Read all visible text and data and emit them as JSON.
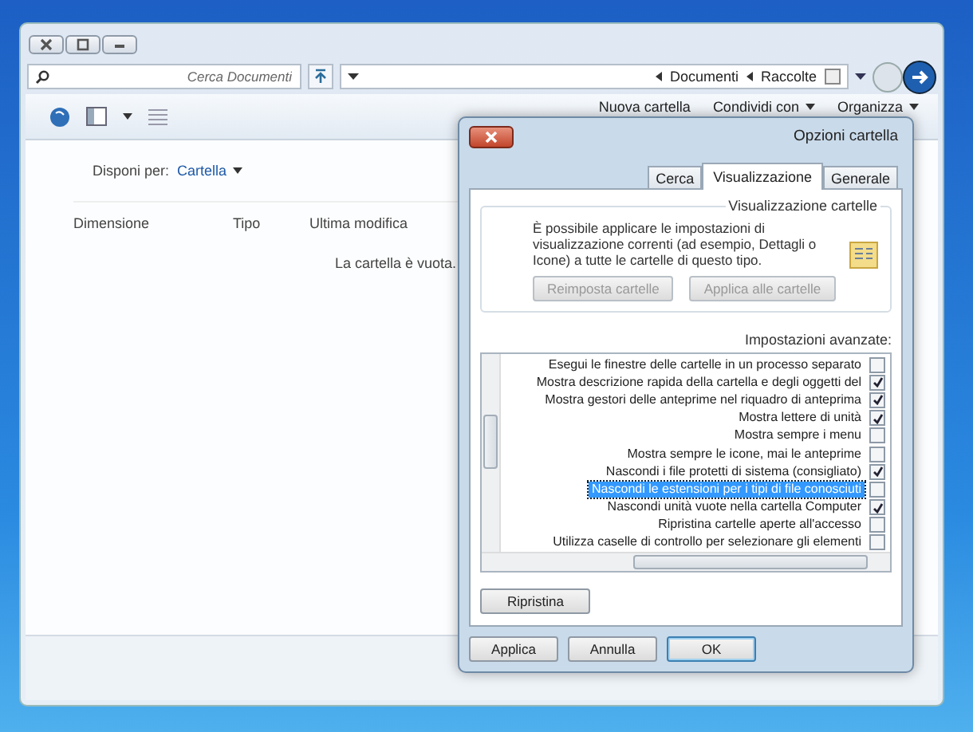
{
  "explorer": {
    "search": {
      "placeholder": "Cerca Documenti"
    },
    "address": {
      "crumbs": [
        "Documenti",
        "Raccolte"
      ]
    },
    "toolbar": {
      "items": [
        {
          "label": "Nuova cartella",
          "dropdown": false
        },
        {
          "label": "Condividi con",
          "dropdown": true
        },
        {
          "label": "Organizza",
          "dropdown": true
        }
      ]
    },
    "arrange": {
      "label": "Disponi per:",
      "value": "Cartella"
    },
    "columns": [
      "Dimensione",
      "Tipo",
      "Ultima modifica"
    ],
    "empty_message": "La cartella è vuota."
  },
  "dialog": {
    "title": "Opzioni cartella",
    "tabs": [
      {
        "label": "Cerca",
        "selected": false
      },
      {
        "label": "Visualizzazione",
        "selected": true
      },
      {
        "label": "Generale",
        "selected": false
      }
    ],
    "group": {
      "title": "Visualizzazione cartelle",
      "text": "È possibile applicare le impostazioni di visualizzazione correnti (ad esempio, Dettagli o Icone) a tutte le cartelle di questo tipo.",
      "buttons": [
        {
          "label": "Reimposta cartelle",
          "disabled": true
        },
        {
          "label": "Applica alle cartelle",
          "disabled": true
        }
      ]
    },
    "advanced_label": "Impostazioni avanzate:",
    "settings": [
      {
        "label": "Esegui le finestre delle cartelle in un processo separato",
        "checked": false,
        "selected": false
      },
      {
        "label": "Mostra descrizione rapida della cartella e degli oggetti del",
        "checked": true,
        "selected": false
      },
      {
        "label": "Mostra gestori delle anteprime nel riquadro di anteprima",
        "checked": true,
        "selected": false
      },
      {
        "label": "Mostra lettere di unità",
        "checked": true,
        "selected": false
      },
      {
        "label": "Mostra sempre i menu",
        "checked": false,
        "selected": false
      },
      {
        "label": "Mostra sempre le icone, mai le anteprime",
        "checked": false,
        "selected": false
      },
      {
        "label": "Nascondi i file protetti di sistema (consigliato)",
        "checked": true,
        "selected": false
      },
      {
        "label": "Nascondi le estensioni per i tipi di file conosciuti",
        "checked": false,
        "selected": true
      },
      {
        "label": "Nascondi unità vuote nella cartella Computer",
        "checked": true,
        "selected": false
      },
      {
        "label": "Ripristina cartelle aperte all'accesso",
        "checked": false,
        "selected": false
      },
      {
        "label": "Utilizza caselle di controllo per selezionare gli elementi",
        "checked": false,
        "selected": false
      }
    ],
    "restore_button": "Ripristina",
    "buttons": [
      {
        "label": "Applica",
        "kind": "normal"
      },
      {
        "label": "Annulla",
        "kind": "normal"
      },
      {
        "label": "OK",
        "kind": "default"
      }
    ]
  }
}
